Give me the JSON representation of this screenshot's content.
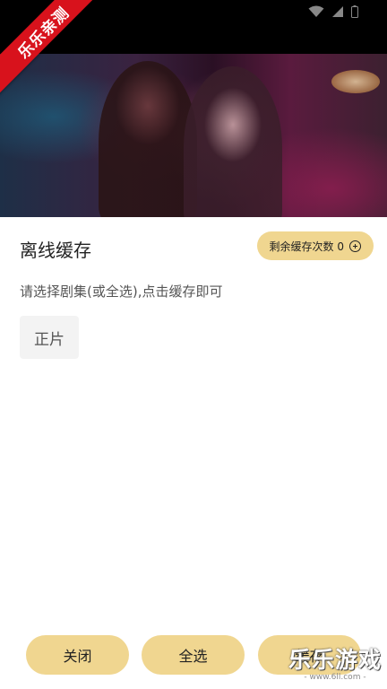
{
  "watermark": {
    "ribbon_text": "乐乐亲测",
    "logo_text": "乐乐游戏",
    "logo_url": "- www.6ll.com -"
  },
  "header": {
    "title": "离线缓存",
    "remaining_label": "剩余缓存次数 0"
  },
  "hint": "请选择剧集(或全选),点击缓存即可",
  "episodes": [
    {
      "label": "正片"
    }
  ],
  "bottom": {
    "close_label": "关闭",
    "select_all_label": "全选",
    "cache_label": "缓存"
  },
  "colors": {
    "accent": "#f0d690",
    "ribbon": "#d8121c"
  },
  "icons": [
    "wifi-icon",
    "signal-icon",
    "battery-icon",
    "add-circle-icon"
  ]
}
